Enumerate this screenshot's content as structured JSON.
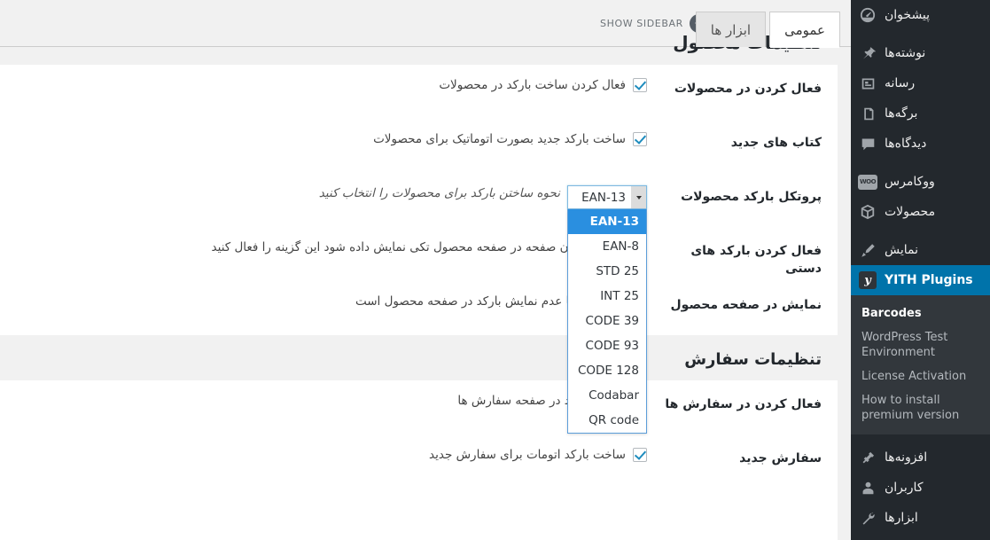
{
  "tabs": [
    {
      "label": "عمومی",
      "active": true
    },
    {
      "label": "ابزار ها",
      "active": false
    }
  ],
  "show_sidebar": {
    "label": "SHOW SIDEBAR"
  },
  "sections": [
    {
      "title": "تنظیمات محصول",
      "rows": [
        {
          "label": "فعال کردن در محصولات",
          "type": "checkbox",
          "checked": true,
          "desc": "فعال کردن ساخت بارکد در محصولات"
        },
        {
          "label": "کتاب های جدید",
          "type": "checkbox",
          "checked": true,
          "desc": "ساخت بارکد جدید بصورت اتوماتیک برای محصولات"
        },
        {
          "label": "پروتکل بارکد محصولات",
          "type": "select",
          "desc": "نحوه ساختن بارکد برای محصولات را انتخاب کنید"
        },
        {
          "label": "فعال کردن بارکد های دستی",
          "type": "checkbox",
          "checked": true,
          "desc": "خواهید عنوان صفحه در صفحه محصول تکی نمایش داده شود این گزینه را فعال کنید"
        },
        {
          "label": "نمایش در صفحه محصول",
          "type": "checkbox",
          "checked": true,
          "desc": "ای نمایش یا عدم نمایش بارکد در صفحه محصول است"
        }
      ]
    },
    {
      "title": "تنظیمات سفارش",
      "rows": [
        {
          "label": "فعال کردن در سفارش ها",
          "type": "checkbox",
          "checked": true,
          "desc": "ساخت بارکد در صفحه سفارش ها"
        },
        {
          "label": "سفارش جدید",
          "type": "checkbox",
          "checked": true,
          "desc": "ساخت بارکد اتومات برای سفارش جدید"
        }
      ]
    }
  ],
  "barcode_select": {
    "value": "EAN-13",
    "options": [
      "EAN-13",
      "EAN-8",
      "STD 25",
      "INT 25",
      "CODE 39",
      "CODE 93",
      "CODE 128",
      "Codabar",
      "QR code"
    ],
    "selected_index": 0
  },
  "sidebar": {
    "items": [
      {
        "label": "پیشخوان",
        "icon": "dashboard-icon",
        "name": "dashboard"
      },
      {
        "sep": true
      },
      {
        "label": "نوشته‌ها",
        "icon": "pin-icon",
        "name": "posts"
      },
      {
        "label": "رسانه",
        "icon": "media-icon",
        "name": "media"
      },
      {
        "label": "برگه‌ها",
        "icon": "pages-icon",
        "name": "pages"
      },
      {
        "label": "دیدگاه‌ها",
        "icon": "comments-icon",
        "name": "comments"
      },
      {
        "sep": true
      },
      {
        "label": "ووکامرس",
        "icon": "woocommerce-icon",
        "name": "woocommerce"
      },
      {
        "label": "محصولات",
        "icon": "products-icon",
        "name": "products"
      },
      {
        "sep": true
      },
      {
        "label": "نمایش",
        "icon": "appearance-icon",
        "name": "appearance"
      },
      {
        "label": "YITH Plugins",
        "icon": "yith-icon",
        "name": "yith-plugins",
        "current": true
      },
      {
        "label": "افزونه‌ها",
        "icon": "plugins-icon",
        "name": "plugins"
      },
      {
        "label": "کاربران",
        "icon": "users-icon",
        "name": "users"
      },
      {
        "label": "ابزارها",
        "icon": "tools-icon",
        "name": "tools"
      }
    ],
    "submenu": [
      {
        "label": "Barcodes",
        "active": true
      },
      {
        "label": "WordPress Test Environment",
        "active": false
      },
      {
        "label": "License Activation",
        "active": false
      },
      {
        "label": "How to install premium version",
        "active": false
      }
    ]
  },
  "colors": {
    "admin_bg": "#23282d",
    "submenu_bg": "#32373c",
    "accent": "#0073aa",
    "select_highlight": "#2a8fe0",
    "page_bg": "#f1f1f1",
    "panel_bg": "#ffffff"
  }
}
